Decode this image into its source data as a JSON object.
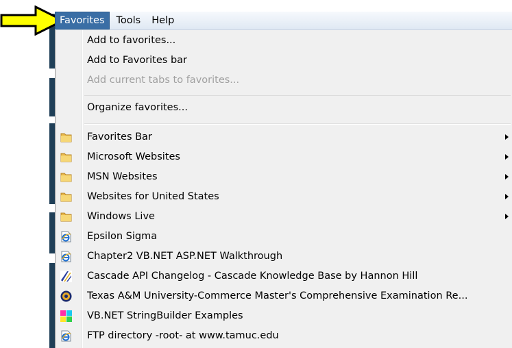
{
  "menubar": {
    "items": [
      {
        "label": "Favorites",
        "active": true
      },
      {
        "label": "Tools",
        "active": false
      },
      {
        "label": "Help",
        "active": false
      }
    ]
  },
  "favorites_menu": {
    "actions": [
      {
        "label": "Add to favorites...",
        "enabled": true
      },
      {
        "label": "Add to Favorites bar",
        "enabled": true
      },
      {
        "label": "Add current tabs to favorites...",
        "enabled": false
      },
      {
        "label": "Organize favorites...",
        "enabled": true
      }
    ],
    "folders": [
      {
        "label": "Favorites Bar",
        "icon": "folder-icon",
        "submenu": true
      },
      {
        "label": "Microsoft Websites",
        "icon": "folder-icon",
        "submenu": true
      },
      {
        "label": "MSN Websites",
        "icon": "folder-icon",
        "submenu": true
      },
      {
        "label": "Websites for United States",
        "icon": "folder-icon",
        "submenu": true
      },
      {
        "label": "Windows Live",
        "icon": "folder-icon",
        "submenu": true
      }
    ],
    "links": [
      {
        "label": "Epsilon Sigma",
        "icon": "ie-page-icon"
      },
      {
        "label": "Chapter2 VB.NET ASP.NET Walkthrough",
        "icon": "ie-page-icon"
      },
      {
        "label": "Cascade API Changelog - Cascade Knowledge Base by Hannon Hill",
        "icon": "cascade-icon"
      },
      {
        "label": "Texas A&M University-Commerce Master's Comprehensive Examination Re...",
        "icon": "tamuc-seal-icon"
      },
      {
        "label": "VB.NET StringBuilder Examples",
        "icon": "color-squares-icon"
      },
      {
        "label": "FTP directory -root- at www.tamuc.edu",
        "icon": "ie-page-icon"
      }
    ]
  },
  "colors": {
    "active_menu_bg": "#3a6ea5",
    "arrow_fill": "#ffff00",
    "disabled_text": "#a0a0a0",
    "menu_bg": "#f0f0f0"
  }
}
